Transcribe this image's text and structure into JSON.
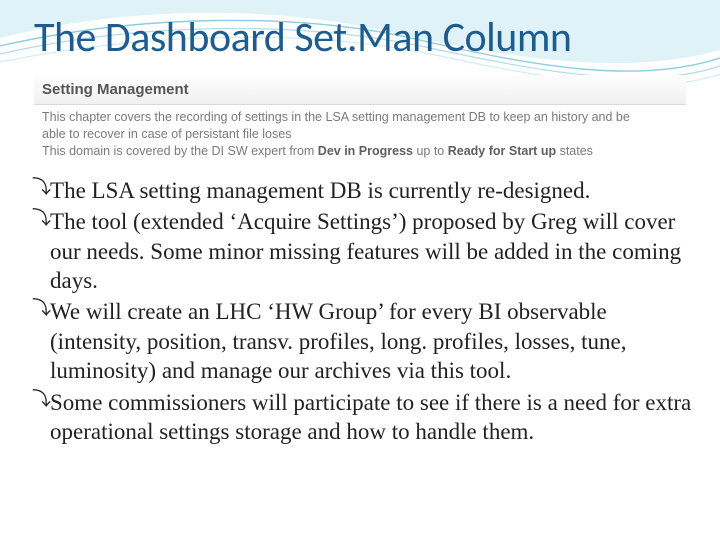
{
  "title": "The Dashboard Set.Man Column",
  "banner": {
    "heading": "Setting Management",
    "line1_a": "This chapter covers the recording of settings in the LSA setting management DB to keep an history and be",
    "line1_b": "able to recover in case of persistant file loses",
    "line2_a": "This domain is covered by the DI SW expert from ",
    "line2_b": "Dev in Progress",
    "line2_c": " up to ",
    "line2_d": "Ready for Start up",
    "line2_e": " states"
  },
  "bullets": [
    "The LSA setting management DB is currently re-designed.",
    "The tool (extended ‘Acquire Settings’) proposed by Greg will cover our needs.  Some minor missing features will be added in the coming days.",
    "We will create an LHC ‘HW Group’ for every BI observable (intensity, position, transv. profiles, long. profiles, losses, tune, luminosity) and manage our archives via this tool.",
    "Some commissioners will participate to see if there is a need for extra operational settings storage and how to handle them."
  ],
  "colors": {
    "titleColor": "#1e5b8f",
    "waveLight": "#bfe6ef",
    "waveMid": "#8fd3e2",
    "waveLine": "#4aa8c4"
  }
}
